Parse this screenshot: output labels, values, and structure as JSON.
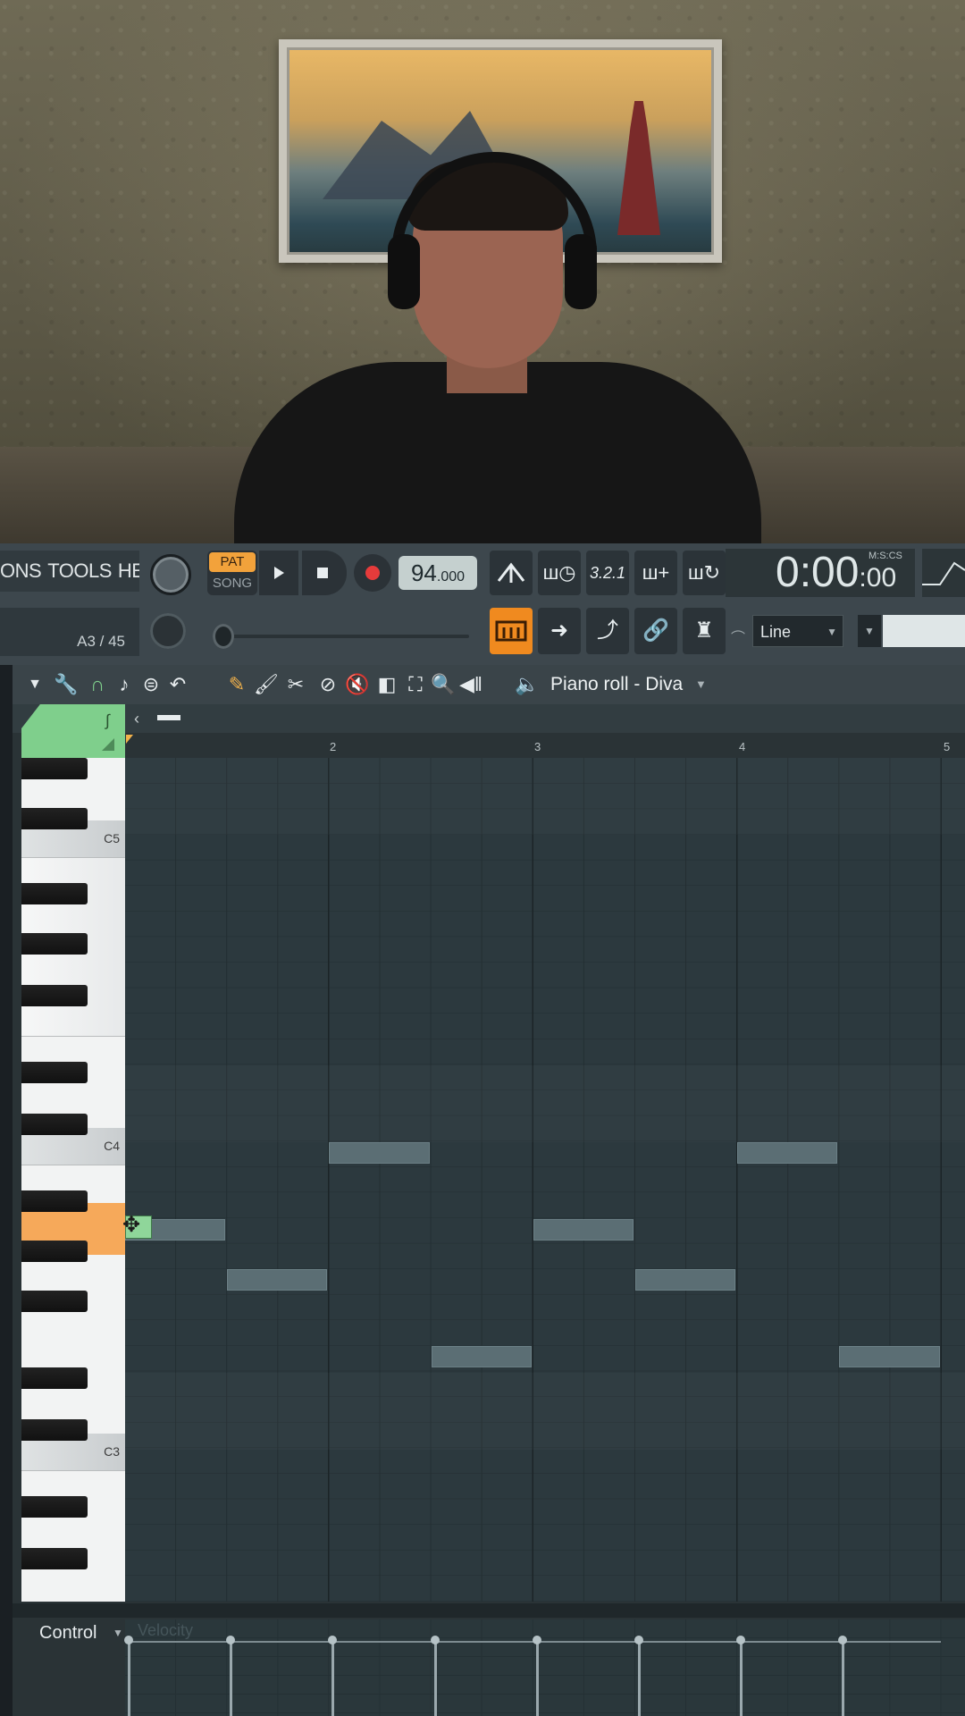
{
  "toolbar": {
    "menu_items": [
      "ONS",
      "TOOLS",
      "HELP"
    ],
    "pat_label": "PAT",
    "song_label": "SONG",
    "tempo_value": "94",
    "tempo_decimals": ".000",
    "time_main": "0:00",
    "time_cs": ":00",
    "time_format_label": "M:S:CS",
    "hint_text": "A3 / 45",
    "snap_mode": "Line",
    "icons": {
      "play": "play-icon",
      "stop": "stop-icon",
      "record": "record-icon",
      "metronome": "metronome-icon",
      "wait": "wait-for-input-icon",
      "countdown": "countdown-icon",
      "step_edit": "step-edit-icon",
      "loop_record": "loop-record-icon",
      "typing_keyboard": "typing-keyboard-icon",
      "arrow": "arrow-icon",
      "curve": "curve-icon",
      "link": "link-icon",
      "mixer": "mixer-icon",
      "magnet": "magnet-icon"
    },
    "tbtn_glyphs": [
      "ш◷",
      "3.2.1",
      "ш+",
      "ш↻"
    ]
  },
  "piano_roll": {
    "title": "Piano roll - Diva",
    "ruler_labels": [
      "2",
      "3",
      "4",
      "5"
    ],
    "key_labels": [
      "C5",
      "C4",
      "C3"
    ],
    "active_key": "A3",
    "tool_icons": [
      "menu-arrow-icon",
      "wrench-icon",
      "magnet-icon",
      "note-icon",
      "list-icon",
      "undo-icon",
      "pencil-icon",
      "brush-icon",
      "chop-icon",
      "delete-icon",
      "mute-icon",
      "slip-icon",
      "select-icon",
      "zoom-icon",
      "playback-icon",
      "speaker-icon"
    ],
    "accent_color": "#7fcf8c",
    "key_highlight_color": "#f6a95a"
  },
  "notes": [
    {
      "start_step": 0,
      "length_steps": 4,
      "pitch": "A3"
    },
    {
      "start_step": 4,
      "length_steps": 4,
      "pitch": "G3"
    },
    {
      "start_step": 8,
      "length_steps": 4,
      "pitch": "C4"
    },
    {
      "start_step": 12,
      "length_steps": 4,
      "pitch": "E3"
    },
    {
      "start_step": 16,
      "length_steps": 4,
      "pitch": "A3"
    },
    {
      "start_step": 20,
      "length_steps": 4,
      "pitch": "G3"
    },
    {
      "start_step": 24,
      "length_steps": 4,
      "pitch": "C4"
    },
    {
      "start_step": 28,
      "length_steps": 4,
      "pitch": "E3"
    }
  ],
  "control": {
    "label": "Control",
    "lane_name": "Velocity",
    "velocity_steps": [
      0,
      4,
      8,
      12,
      16,
      20,
      24,
      28
    ]
  }
}
